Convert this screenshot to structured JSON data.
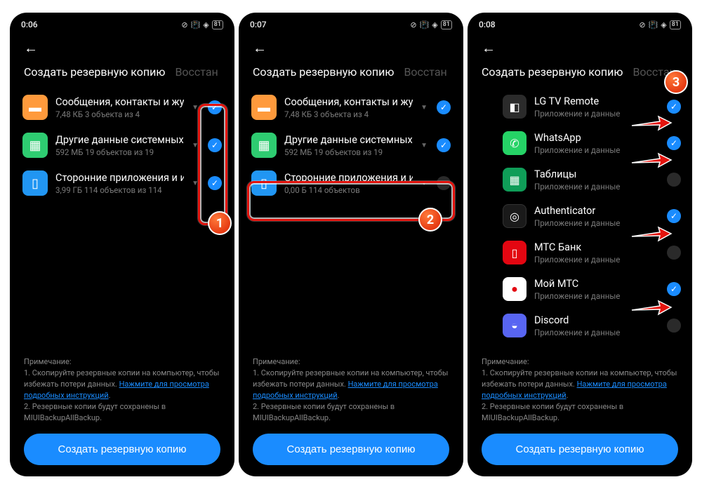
{
  "screens": [
    {
      "time": "0:06",
      "battery": "81"
    },
    {
      "time": "0:07",
      "battery": "81"
    },
    {
      "time": "0:08",
      "battery": "81"
    }
  ],
  "tabs": {
    "active": "Создать резервную копию",
    "inactive": "Восстан"
  },
  "screen1": {
    "cats": [
      {
        "title": "Сообщения, контакты и жур",
        "sub": "7,48 КБ  3 объекта из 4",
        "checked": true,
        "icon": "orange"
      },
      {
        "title": "Другие данные системных п",
        "sub": "592 МБ  19 объектов из 19",
        "checked": true,
        "icon": "green"
      },
      {
        "title": "Сторонние приложения и их",
        "sub": "3,99 ГБ  114 объектов из 114",
        "checked": true,
        "icon": "blue"
      }
    ]
  },
  "screen2": {
    "cats": [
      {
        "title": "Сообщения, контакты и жур",
        "sub": "7,48 КБ  3 объекта из 4",
        "checked": true,
        "icon": "orange"
      },
      {
        "title": "Другие данные системных п",
        "sub": "592 МБ  19 объектов из 19",
        "checked": true,
        "icon": "green"
      },
      {
        "title": "Сторонние приложения и их",
        "sub": "0,00 Б  114 объектов",
        "checked": false,
        "icon": "blue"
      }
    ]
  },
  "screen3": {
    "apps": [
      {
        "title": "LG TV Remote",
        "sub": "Приложение и данные",
        "checked": true,
        "icon": "dark"
      },
      {
        "title": "WhatsApp",
        "sub": "Приложение и данные",
        "checked": true,
        "icon": "wa"
      },
      {
        "title": "Таблицы",
        "sub": "Приложение и данные",
        "checked": false,
        "icon": "gsheets"
      },
      {
        "title": "Authenticator",
        "sub": "Приложение и данные",
        "checked": true,
        "icon": "auth"
      },
      {
        "title": "МТС Банк",
        "sub": "Приложение и данные",
        "checked": false,
        "icon": "mts"
      },
      {
        "title": "Мой МТС",
        "sub": "Приложение и данные",
        "checked": true,
        "icon": "mymts"
      },
      {
        "title": "Discord",
        "sub": "Приложение и данные",
        "checked": false,
        "icon": "discord"
      }
    ]
  },
  "note": {
    "header": "Примечание:",
    "l1a": "1. Скопируйте резервные копии на компьютер, чтобы избежать потери данных. ",
    "l1link": "Нажмите для просмотра подробных инструкций",
    "l1b": ".",
    "l2": "2. Резервные копии будут сохранены в MIUIBackupAllBackup."
  },
  "button": "Создать резервную копию",
  "badges": {
    "b1": "1",
    "b2": "2",
    "b3": "3"
  }
}
